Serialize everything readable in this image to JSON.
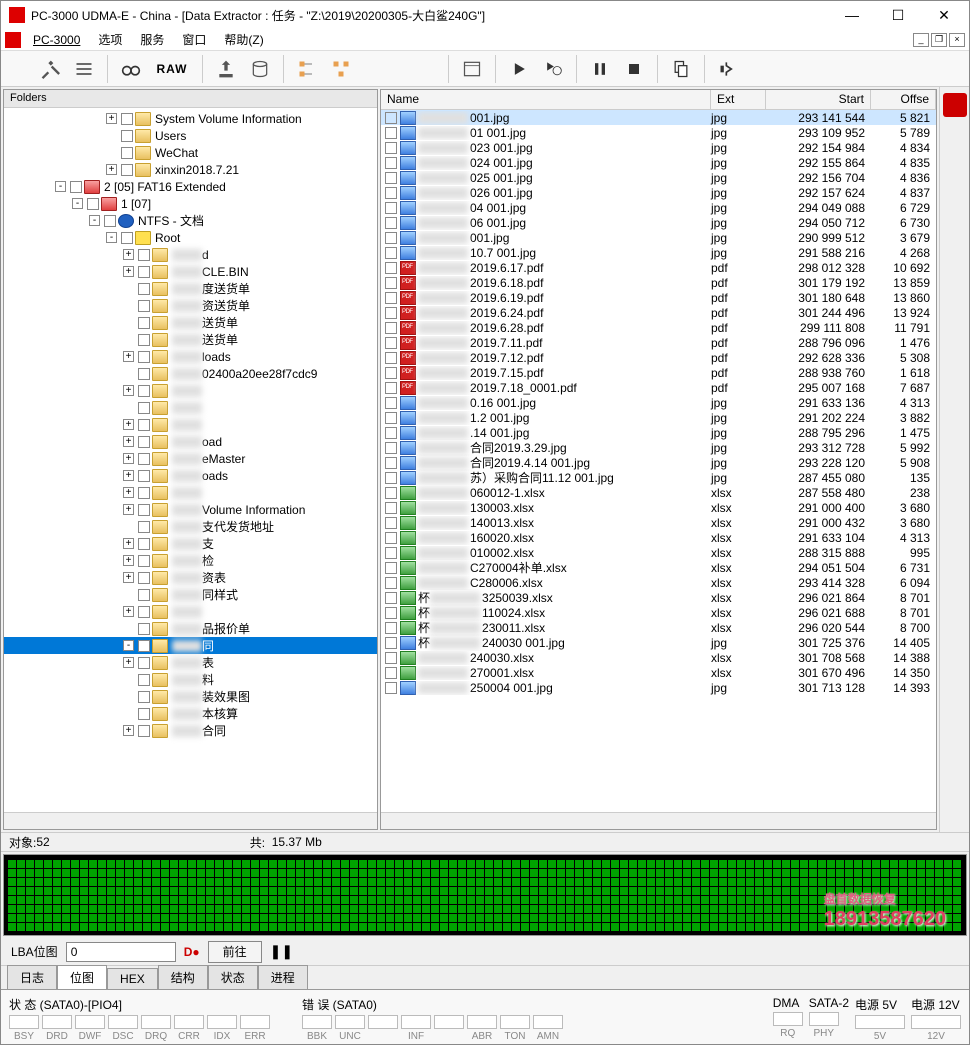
{
  "title": "PC-3000 UDMA-E - China - [Data Extractor : 任务 - \"Z:\\2019\\20200305-大白鲨240G\"]",
  "menu": {
    "app": "PC-3000",
    "opts": "选项",
    "svc": "服务",
    "win": "窗口",
    "help": "帮助(Z)"
  },
  "toolbar": {
    "raw": "RAW"
  },
  "leftHeader": "Folders",
  "tree": [
    {
      "d": 6,
      "exp": "+",
      "name": "System Volume Information"
    },
    {
      "d": 6,
      "exp": "",
      "name": "Users"
    },
    {
      "d": 6,
      "exp": "",
      "name": "WeChat"
    },
    {
      "d": 6,
      "exp": "+",
      "name": "xinxin2018.7.21"
    },
    {
      "d": 3,
      "exp": "-",
      "ico": "part",
      "name": "2 [05] FAT16 Extended"
    },
    {
      "d": 4,
      "exp": "-",
      "ico": "part",
      "name": "1 [07]"
    },
    {
      "d": 5,
      "exp": "-",
      "ico": "ntfs",
      "name": "NTFS - 文档"
    },
    {
      "d": 6,
      "exp": "-",
      "ico": "root",
      "name": "Root"
    },
    {
      "d": 7,
      "exp": "+",
      "blur": "S",
      "suffix": "d"
    },
    {
      "d": 7,
      "exp": "+",
      "blur": "$",
      "suffix": "CLE.BIN"
    },
    {
      "d": 7,
      "exp": "",
      "blur": "20",
      "suffix": "度送货单"
    },
    {
      "d": 7,
      "exp": "",
      "blur": "20",
      "suffix": "资送货单"
    },
    {
      "d": 7,
      "exp": "",
      "blur": "20",
      "suffix": "送货单"
    },
    {
      "d": 7,
      "exp": "",
      "blur": "20",
      "suffix": "送货单"
    },
    {
      "d": 7,
      "exp": "+",
      "blur": "36",
      "suffix": "loads"
    },
    {
      "d": 7,
      "exp": "",
      "blur": "df6",
      "suffix": "02400a20ee28f7cdc9"
    },
    {
      "d": 7,
      "exp": "+",
      "blur": "Hl",
      "suffix": ""
    },
    {
      "d": 7,
      "exp": "",
      "blur": "HL",
      "suffix": ""
    },
    {
      "d": 7,
      "exp": "+",
      "blur": "Ku",
      "suffix": ""
    },
    {
      "d": 7,
      "exp": "+",
      "blur": "Kw",
      "suffix": "oad"
    },
    {
      "d": 7,
      "exp": "+",
      "blur": "LD",
      "suffix": "eMaster"
    },
    {
      "d": 7,
      "exp": "+",
      "blur": "My",
      "suffix": "oads"
    },
    {
      "d": 7,
      "exp": "+",
      "blur": "qy",
      "suffix": ""
    },
    {
      "d": 7,
      "exp": "+",
      "blur": "Sy",
      "suffix": "Volume Information"
    },
    {
      "d": 7,
      "exp": "",
      "blur": "上",
      "suffix": "支代发货地址"
    },
    {
      "d": 7,
      "exp": "+",
      "blur": "代",
      "suffix": "支"
    },
    {
      "d": 7,
      "exp": "+",
      "blur": "员",
      "suffix": "检"
    },
    {
      "d": 7,
      "exp": "+",
      "blur": "员",
      "suffix": "资表"
    },
    {
      "d": 7,
      "exp": "",
      "blur": "丁",
      "suffix": "同样式"
    },
    {
      "d": 7,
      "exp": "+",
      "blur": "巨",
      "suffix": ""
    },
    {
      "d": 7,
      "exp": "",
      "blur": "巨",
      "suffix": "品报价单"
    },
    {
      "d": 7,
      "exp": "-",
      "sel": true,
      "blur": "巨",
      "suffix": "同"
    },
    {
      "d": 7,
      "exp": "+",
      "blur": "杯",
      "suffix": "表"
    },
    {
      "d": 7,
      "exp": "",
      "blur": "杯",
      "suffix": "料"
    },
    {
      "d": 7,
      "exp": "",
      "blur": "约",
      "suffix": "装效果图"
    },
    {
      "d": 7,
      "exp": "",
      "blur": "丰",
      "suffix": "本核算"
    },
    {
      "d": 7,
      "exp": "+",
      "blur": "丰",
      "suffix": "合同"
    }
  ],
  "cols": {
    "name": "Name",
    "ext": "Ext",
    "start": "Start",
    "offse": "Offse"
  },
  "files": [
    {
      "t": "jpg",
      "suf": "001.jpg",
      "ext": "jpg",
      "start": "293 141 544",
      "off": "5 821",
      "sel": true
    },
    {
      "t": "jpg",
      "suf": "01 001.jpg",
      "ext": "jpg",
      "start": "293 109 952",
      "off": "5 789"
    },
    {
      "t": "jpg",
      "suf": "023 001.jpg",
      "ext": "jpg",
      "start": "292 154 984",
      "off": "4 834"
    },
    {
      "t": "jpg",
      "suf": "024 001.jpg",
      "ext": "jpg",
      "start": "292 155 864",
      "off": "4 835"
    },
    {
      "t": "jpg",
      "suf": "025 001.jpg",
      "ext": "jpg",
      "start": "292 156 704",
      "off": "4 836"
    },
    {
      "t": "jpg",
      "suf": "026 001.jpg",
      "ext": "jpg",
      "start": "292 157 624",
      "off": "4 837"
    },
    {
      "t": "jpg",
      "suf": "04 001.jpg",
      "ext": "jpg",
      "start": "294 049 088",
      "off": "6 729"
    },
    {
      "t": "jpg",
      "suf": "06 001.jpg",
      "ext": "jpg",
      "start": "294 050 712",
      "off": "6 730"
    },
    {
      "t": "jpg",
      "suf": "001.jpg",
      "ext": "jpg",
      "start": "290 999 512",
      "off": "3 679"
    },
    {
      "t": "jpg",
      "suf": "10.7 001.jpg",
      "ext": "jpg",
      "start": "291 588 216",
      "off": "4 268"
    },
    {
      "t": "pdf",
      "suf": "2019.6.17.pdf",
      "ext": "pdf",
      "start": "298 012 328",
      "off": "10 692"
    },
    {
      "t": "pdf",
      "suf": "2019.6.18.pdf",
      "ext": "pdf",
      "start": "301 179 192",
      "off": "13 859"
    },
    {
      "t": "pdf",
      "suf": "2019.6.19.pdf",
      "ext": "pdf",
      "start": "301 180 648",
      "off": "13 860"
    },
    {
      "t": "pdf",
      "suf": "2019.6.24.pdf",
      "ext": "pdf",
      "start": "301 244 496",
      "off": "13 924"
    },
    {
      "t": "pdf",
      "suf": "2019.6.28.pdf",
      "ext": "pdf",
      "start": "299 111 808",
      "off": "11 791"
    },
    {
      "t": "pdf",
      "suf": "2019.7.11.pdf",
      "ext": "pdf",
      "start": "288 796 096",
      "off": "1 476"
    },
    {
      "t": "pdf",
      "suf": "2019.7.12.pdf",
      "ext": "pdf",
      "start": "292 628 336",
      "off": "5 308"
    },
    {
      "t": "pdf",
      "suf": "2019.7.15.pdf",
      "ext": "pdf",
      "start": "288 938 760",
      "off": "1 618"
    },
    {
      "t": "pdf",
      "suf": "2019.7.18_0001.pdf",
      "ext": "pdf",
      "start": "295 007 168",
      "off": "7 687"
    },
    {
      "t": "jpg",
      "suf": "0.16 001.jpg",
      "ext": "jpg",
      "start": "291 633 136",
      "off": "4 313"
    },
    {
      "t": "jpg",
      "suf": "1.2 001.jpg",
      "ext": "jpg",
      "start": "291 202 224",
      "off": "3 882"
    },
    {
      "t": "jpg",
      "suf": ".14 001.jpg",
      "ext": "jpg",
      "start": "288 795 296",
      "off": "1 475"
    },
    {
      "t": "jpg",
      "suf": "合同2019.3.29.jpg",
      "ext": "jpg",
      "start": "293 312 728",
      "off": "5 992"
    },
    {
      "t": "jpg",
      "suf": "合同2019.4.14 001.jpg",
      "ext": "jpg",
      "start": "293 228 120",
      "off": "5 908"
    },
    {
      "t": "jpg",
      "suf": "苏）采购合同11.12 001.jpg",
      "ext": "jpg",
      "start": "287 455 080",
      "off": "135"
    },
    {
      "t": "xlsx",
      "suf": "060012-1.xlsx",
      "ext": "xlsx",
      "start": "287 558 480",
      "off": "238"
    },
    {
      "t": "xlsx",
      "suf": "130003.xlsx",
      "ext": "xlsx",
      "start": "291 000 400",
      "off": "3 680"
    },
    {
      "t": "xlsx",
      "suf": "140013.xlsx",
      "ext": "xlsx",
      "start": "291 000 432",
      "off": "3 680"
    },
    {
      "t": "xlsx",
      "suf": "160020.xlsx",
      "ext": "xlsx",
      "start": "291 633 104",
      "off": "4 313"
    },
    {
      "t": "xlsx",
      "suf": "010002.xlsx",
      "ext": "xlsx",
      "start": "288 315 888",
      "off": "995"
    },
    {
      "t": "xlsx",
      "suf": "C270004补单.xlsx",
      "ext": "xlsx",
      "start": "294 051 504",
      "off": "6 731"
    },
    {
      "t": "xlsx",
      "suf": "C280006.xlsx",
      "ext": "xlsx",
      "start": "293 414 328",
      "off": "6 094"
    },
    {
      "t": "xlsx",
      "pre": "杯",
      "suf": "3250039.xlsx",
      "ext": "xlsx",
      "start": "296 021 864",
      "off": "8 701"
    },
    {
      "t": "xlsx",
      "pre": "杯",
      "suf": "110024.xlsx",
      "ext": "xlsx",
      "start": "296 021 688",
      "off": "8 701"
    },
    {
      "t": "xlsx",
      "pre": "杯",
      "suf": "230011.xlsx",
      "ext": "xlsx",
      "start": "296 020 544",
      "off": "8 700"
    },
    {
      "t": "jpg",
      "pre": "杯",
      "suf": "240030 001.jpg",
      "ext": "jpg",
      "start": "301 725 376",
      "off": "14 405"
    },
    {
      "t": "xlsx",
      "suf": "240030.xlsx",
      "ext": "xlsx",
      "start": "301 708 568",
      "off": "14 388"
    },
    {
      "t": "xlsx",
      "suf": "270001.xlsx",
      "ext": "xlsx",
      "start": "301 670 496",
      "off": "14 350"
    },
    {
      "t": "jpg",
      "suf": "250004 001.jpg",
      "ext": "jpg",
      "start": "301 713 128",
      "off": "14 393"
    }
  ],
  "status": {
    "objLabel": "对象:",
    "objCount": "52",
    "sizeLabel": "共:",
    "size": "15.37 Mb"
  },
  "lba": {
    "label": "LBA位图",
    "value": "0",
    "go": "前往"
  },
  "tabs": [
    "日志",
    "位图",
    "HEX",
    "结构",
    "状态",
    "进程"
  ],
  "activeTab": 1,
  "watermark": {
    "text": "盘首数据恢复",
    "phone": "18913587620"
  },
  "bottom": {
    "g1": {
      "label": "状 态 (SATA0)-[PIO4]",
      "items": [
        "BSY",
        "DRD",
        "DWF",
        "DSC",
        "DRQ",
        "CRR",
        "IDX",
        "ERR"
      ]
    },
    "g2": {
      "label": "错 误 (SATA0)",
      "items": [
        "BBK",
        "UNC",
        "",
        "INF",
        "",
        "ABR",
        "TON",
        "AMN"
      ]
    },
    "g3": {
      "label": "DMA",
      "items": [
        "RQ"
      ]
    },
    "g4": {
      "label": "SATA-2",
      "items": [
        "PHY"
      ]
    },
    "g5": {
      "label": "电源 5V",
      "items": [
        "5V"
      ]
    },
    "g6": {
      "label": "电源 12V",
      "items": [
        "12V"
      ]
    }
  }
}
